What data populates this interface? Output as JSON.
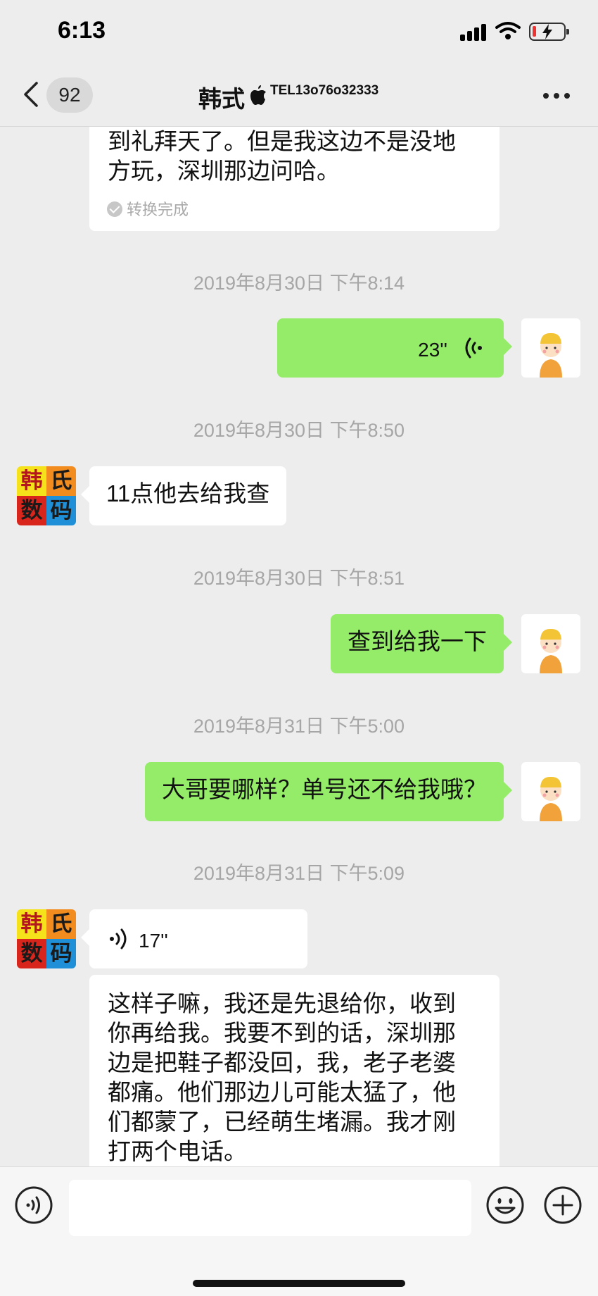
{
  "status_bar": {
    "time": "6:13"
  },
  "nav": {
    "unread_count": "92",
    "title": "韩式",
    "subtitle": "TEL13o76o32333",
    "icons": {
      "back": "chevron-left-icon",
      "brand": "apple-icon",
      "more": "ellipsis-icon"
    }
  },
  "messages": {
    "m0": {
      "side": "in",
      "line1": "到礼拜天了。但是我这边不是没地",
      "line2": "方玩，深圳那边问哈。",
      "status": "转换完成"
    },
    "t1": "2019年8月30日 下午8:14",
    "m1": {
      "side": "out",
      "type": "voice",
      "duration": "23''"
    },
    "t2": "2019年8月30日 下午8:50",
    "m2": {
      "side": "in",
      "text": "11点他去给我查"
    },
    "t3": "2019年8月30日 下午8:51",
    "m3": {
      "side": "out",
      "text": "查到给我一下"
    },
    "t4": "2019年8月31日 下午5:00",
    "m4": {
      "side": "out",
      "text": "大哥要哪样？单号还不给我哦？"
    },
    "t5": "2019年8月31日 下午5:09",
    "m5": {
      "side": "in",
      "type": "voice",
      "duration": "17''"
    },
    "m6": {
      "side": "in",
      "lines": [
        "这样子嘛，我还是先退给你，收到",
        "你再给我。我要不到的话，深圳那",
        "边是把鞋子都没回，我，老子老婆",
        "都痛。他们那边儿可能太猛了，他",
        "们都蒙了，已经萌生堵漏。我才刚",
        "打两个电话。"
      ]
    }
  },
  "contact_avatar": {
    "chars": [
      "韩",
      "氏",
      "数",
      "码"
    ],
    "colors": [
      "#f6e21a",
      "#f28c1e",
      "#d8261c",
      "#1f8fd8"
    ]
  },
  "input_bar": {
    "placeholder": "",
    "icons": {
      "voice": "voice-mode-icon",
      "emoji": "emoji-icon",
      "plus": "plus-icon"
    }
  },
  "theme": {
    "out_bubble": "#95ec69",
    "in_bubble": "#ffffff",
    "background": "#ededed"
  }
}
